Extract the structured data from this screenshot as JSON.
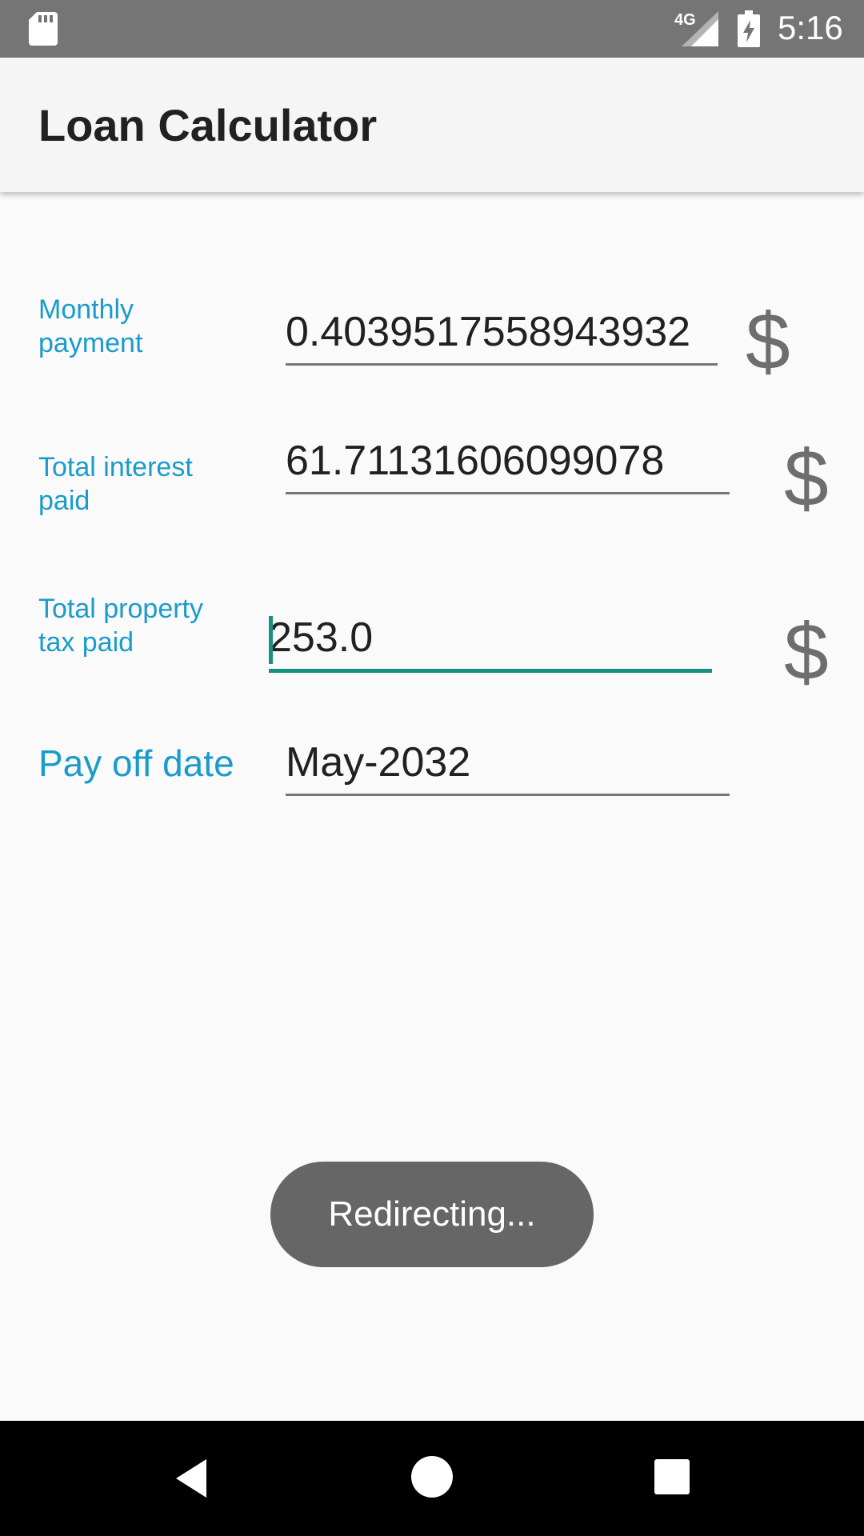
{
  "status_bar": {
    "network": "4G",
    "time": "5:16",
    "icons": [
      "sd-card-icon",
      "signal-icon",
      "battery-charging-icon"
    ]
  },
  "app_bar": {
    "title": "Loan Calculator"
  },
  "form": {
    "monthly_payment": {
      "label": "Monthly payment",
      "value": "0.4039517558943932",
      "suffix": "$"
    },
    "total_interest": {
      "label": "Total interest paid",
      "value": "61.71131606099078",
      "suffix": "$"
    },
    "total_property_tax": {
      "label": "Total property tax paid",
      "value": "253.0",
      "suffix": "$"
    },
    "pay_off_date": {
      "label": "Pay off date",
      "value": "May-2032"
    }
  },
  "toast": {
    "message": "Redirecting..."
  },
  "nav_bar": {
    "icons": [
      "back-icon",
      "home-icon",
      "recents-icon"
    ]
  },
  "colors": {
    "accent": "#17917f",
    "label": "#1a9bcc",
    "status_bar": "#757575",
    "toast": "#666666"
  }
}
